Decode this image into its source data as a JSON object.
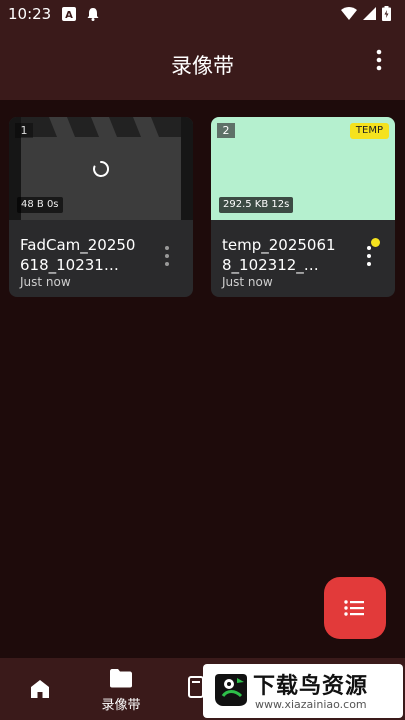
{
  "status_bar": {
    "time": "10:23",
    "left_icons": [
      "app-a-icon",
      "notification-bell-icon"
    ],
    "right_icons": [
      "wifi-icon",
      "cellular-signal-icon",
      "battery-charging-icon"
    ]
  },
  "app_bar": {
    "title": "录像带",
    "overflow_icon": "more-vertical-icon"
  },
  "recordings": [
    {
      "index": "1",
      "meta": "48 B  0s",
      "title": "FadCam_20250618_10231…",
      "subtitle": "Just now",
      "thumb_color": "#3c3c3c",
      "loading": true
    },
    {
      "index": "2",
      "meta": "292.5 KB  12s",
      "title": "temp_20250618_102312_…",
      "subtitle": "Just now",
      "thumb_color": "#b5f0cf",
      "badge": "TEMP",
      "unread_dot_color": "#f5e21e"
    }
  ],
  "fab": {
    "icon": "list-icon",
    "color": "#e23a3a"
  },
  "bottom_nav": {
    "items": [
      {
        "icon": "home-icon",
        "label": ""
      },
      {
        "icon": "folder-icon",
        "label": "录像带"
      },
      {
        "icon": "partial-icon",
        "label": ""
      }
    ]
  },
  "watermark": {
    "title": "下载鸟资源",
    "subtitle": "www.xiazainiao.com"
  },
  "colors": {
    "surface": "#3a1a1a",
    "background": "#1e0b0b",
    "card": "#2a2a2c",
    "accent": "#e23a3a",
    "temp": "#f5e21e"
  }
}
